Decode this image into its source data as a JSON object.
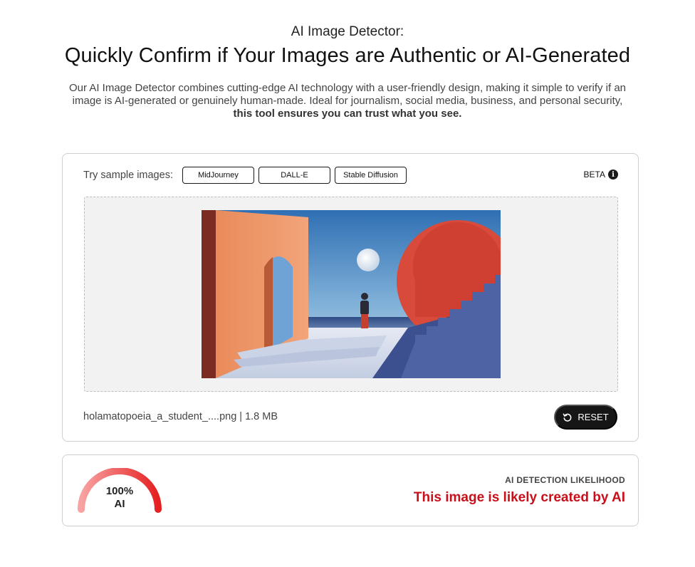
{
  "header": {
    "eyebrow": "AI Image Detector:",
    "headline": "Quickly Confirm if Your Images are Authentic or AI-Generated",
    "description_main": "Our AI Image Detector combines cutting-edge AI technology with a user-friendly design, making it simple to verify if an image is AI-generated or genuinely human-made. Ideal for journalism, social media, business, and personal security,",
    "description_bold": "this tool ensures you can trust what you see."
  },
  "samples": {
    "label": "Try sample images:",
    "chips": [
      "MidJourney",
      "DALL-E",
      "Stable Diffusion"
    ]
  },
  "beta": {
    "label": "BETA",
    "icon": "info-icon"
  },
  "file": {
    "info": "holamatopoeia_a_student_....png | 1.8 MB"
  },
  "reset_button": {
    "label": "RESET",
    "icon": "reset-icon"
  },
  "result": {
    "percent": "100%",
    "verdict_short": "AI",
    "likelihood_value": 1.0,
    "likelihood_label": "AI DETECTION LIKELIHOOD",
    "verdict": "This image is likely created by AI",
    "gauge_colors": [
      "#f8a3a3",
      "#e62020"
    ],
    "verdict_color": "#c8101b"
  }
}
